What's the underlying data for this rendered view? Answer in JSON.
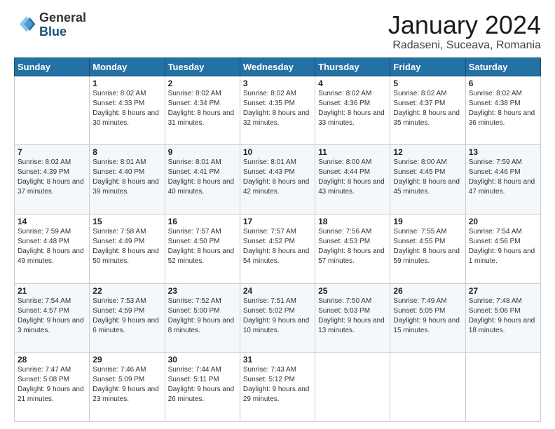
{
  "header": {
    "logo_general": "General",
    "logo_blue": "Blue",
    "month_title": "January 2024",
    "subtitle": "Radaseni, Suceava, Romania"
  },
  "days_of_week": [
    "Sunday",
    "Monday",
    "Tuesday",
    "Wednesday",
    "Thursday",
    "Friday",
    "Saturday"
  ],
  "weeks": [
    [
      {
        "day": "",
        "sunrise": "",
        "sunset": "",
        "daylight": ""
      },
      {
        "day": "1",
        "sunrise": "Sunrise: 8:02 AM",
        "sunset": "Sunset: 4:33 PM",
        "daylight": "Daylight: 8 hours and 30 minutes."
      },
      {
        "day": "2",
        "sunrise": "Sunrise: 8:02 AM",
        "sunset": "Sunset: 4:34 PM",
        "daylight": "Daylight: 8 hours and 31 minutes."
      },
      {
        "day": "3",
        "sunrise": "Sunrise: 8:02 AM",
        "sunset": "Sunset: 4:35 PM",
        "daylight": "Daylight: 8 hours and 32 minutes."
      },
      {
        "day": "4",
        "sunrise": "Sunrise: 8:02 AM",
        "sunset": "Sunset: 4:36 PM",
        "daylight": "Daylight: 8 hours and 33 minutes."
      },
      {
        "day": "5",
        "sunrise": "Sunrise: 8:02 AM",
        "sunset": "Sunset: 4:37 PM",
        "daylight": "Daylight: 8 hours and 35 minutes."
      },
      {
        "day": "6",
        "sunrise": "Sunrise: 8:02 AM",
        "sunset": "Sunset: 4:38 PM",
        "daylight": "Daylight: 8 hours and 36 minutes."
      }
    ],
    [
      {
        "day": "7",
        "sunrise": "Sunrise: 8:02 AM",
        "sunset": "Sunset: 4:39 PM",
        "daylight": "Daylight: 8 hours and 37 minutes."
      },
      {
        "day": "8",
        "sunrise": "Sunrise: 8:01 AM",
        "sunset": "Sunset: 4:40 PM",
        "daylight": "Daylight: 8 hours and 39 minutes."
      },
      {
        "day": "9",
        "sunrise": "Sunrise: 8:01 AM",
        "sunset": "Sunset: 4:41 PM",
        "daylight": "Daylight: 8 hours and 40 minutes."
      },
      {
        "day": "10",
        "sunrise": "Sunrise: 8:01 AM",
        "sunset": "Sunset: 4:43 PM",
        "daylight": "Daylight: 8 hours and 42 minutes."
      },
      {
        "day": "11",
        "sunrise": "Sunrise: 8:00 AM",
        "sunset": "Sunset: 4:44 PM",
        "daylight": "Daylight: 8 hours and 43 minutes."
      },
      {
        "day": "12",
        "sunrise": "Sunrise: 8:00 AM",
        "sunset": "Sunset: 4:45 PM",
        "daylight": "Daylight: 8 hours and 45 minutes."
      },
      {
        "day": "13",
        "sunrise": "Sunrise: 7:59 AM",
        "sunset": "Sunset: 4:46 PM",
        "daylight": "Daylight: 8 hours and 47 minutes."
      }
    ],
    [
      {
        "day": "14",
        "sunrise": "Sunrise: 7:59 AM",
        "sunset": "Sunset: 4:48 PM",
        "daylight": "Daylight: 8 hours and 49 minutes."
      },
      {
        "day": "15",
        "sunrise": "Sunrise: 7:58 AM",
        "sunset": "Sunset: 4:49 PM",
        "daylight": "Daylight: 8 hours and 50 minutes."
      },
      {
        "day": "16",
        "sunrise": "Sunrise: 7:57 AM",
        "sunset": "Sunset: 4:50 PM",
        "daylight": "Daylight: 8 hours and 52 minutes."
      },
      {
        "day": "17",
        "sunrise": "Sunrise: 7:57 AM",
        "sunset": "Sunset: 4:52 PM",
        "daylight": "Daylight: 8 hours and 54 minutes."
      },
      {
        "day": "18",
        "sunrise": "Sunrise: 7:56 AM",
        "sunset": "Sunset: 4:53 PM",
        "daylight": "Daylight: 8 hours and 57 minutes."
      },
      {
        "day": "19",
        "sunrise": "Sunrise: 7:55 AM",
        "sunset": "Sunset: 4:55 PM",
        "daylight": "Daylight: 8 hours and 59 minutes."
      },
      {
        "day": "20",
        "sunrise": "Sunrise: 7:54 AM",
        "sunset": "Sunset: 4:56 PM",
        "daylight": "Daylight: 9 hours and 1 minute."
      }
    ],
    [
      {
        "day": "21",
        "sunrise": "Sunrise: 7:54 AM",
        "sunset": "Sunset: 4:57 PM",
        "daylight": "Daylight: 9 hours and 3 minutes."
      },
      {
        "day": "22",
        "sunrise": "Sunrise: 7:53 AM",
        "sunset": "Sunset: 4:59 PM",
        "daylight": "Daylight: 9 hours and 6 minutes."
      },
      {
        "day": "23",
        "sunrise": "Sunrise: 7:52 AM",
        "sunset": "Sunset: 5:00 PM",
        "daylight": "Daylight: 9 hours and 8 minutes."
      },
      {
        "day": "24",
        "sunrise": "Sunrise: 7:51 AM",
        "sunset": "Sunset: 5:02 PM",
        "daylight": "Daylight: 9 hours and 10 minutes."
      },
      {
        "day": "25",
        "sunrise": "Sunrise: 7:50 AM",
        "sunset": "Sunset: 5:03 PM",
        "daylight": "Daylight: 9 hours and 13 minutes."
      },
      {
        "day": "26",
        "sunrise": "Sunrise: 7:49 AM",
        "sunset": "Sunset: 5:05 PM",
        "daylight": "Daylight: 9 hours and 15 minutes."
      },
      {
        "day": "27",
        "sunrise": "Sunrise: 7:48 AM",
        "sunset": "Sunset: 5:06 PM",
        "daylight": "Daylight: 9 hours and 18 minutes."
      }
    ],
    [
      {
        "day": "28",
        "sunrise": "Sunrise: 7:47 AM",
        "sunset": "Sunset: 5:08 PM",
        "daylight": "Daylight: 9 hours and 21 minutes."
      },
      {
        "day": "29",
        "sunrise": "Sunrise: 7:46 AM",
        "sunset": "Sunset: 5:09 PM",
        "daylight": "Daylight: 9 hours and 23 minutes."
      },
      {
        "day": "30",
        "sunrise": "Sunrise: 7:44 AM",
        "sunset": "Sunset: 5:11 PM",
        "daylight": "Daylight: 9 hours and 26 minutes."
      },
      {
        "day": "31",
        "sunrise": "Sunrise: 7:43 AM",
        "sunset": "Sunset: 5:12 PM",
        "daylight": "Daylight: 9 hours and 29 minutes."
      },
      {
        "day": "",
        "sunrise": "",
        "sunset": "",
        "daylight": ""
      },
      {
        "day": "",
        "sunrise": "",
        "sunset": "",
        "daylight": ""
      },
      {
        "day": "",
        "sunrise": "",
        "sunset": "",
        "daylight": ""
      }
    ]
  ]
}
